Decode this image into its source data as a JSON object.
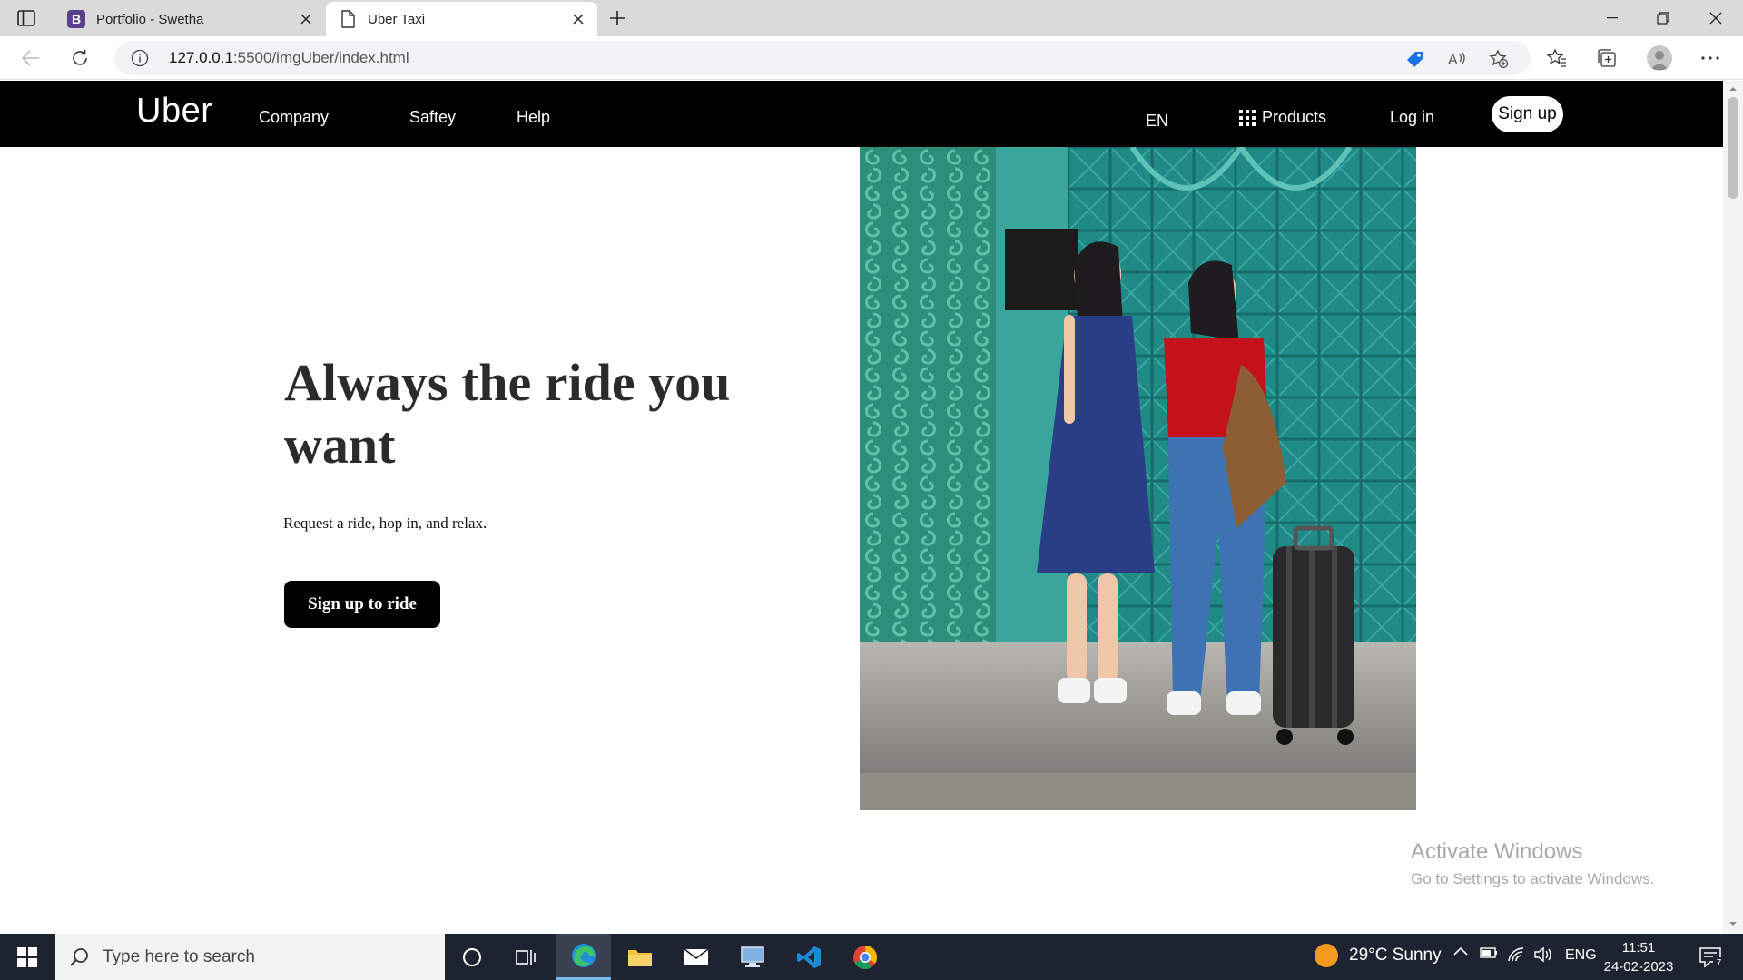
{
  "browser": {
    "tabs": [
      {
        "title": "Portfolio - Swetha",
        "favicon": "B",
        "favicon_color": "#5b3f8c"
      },
      {
        "title": "Uber Taxi"
      }
    ],
    "url_host": "127.0.0.1",
    "url_rest": ":5500/imgUber/index.html"
  },
  "site": {
    "logo": "Uber",
    "nav": {
      "company": "Company",
      "safety": "Saftey",
      "help": "Help",
      "lang": "EN",
      "products": "Products",
      "login": "Log in",
      "signup": "Sign up"
    },
    "hero": {
      "title": "Always the ride you want",
      "subtitle": "Request a ride, hop in, and relax.",
      "cta": "Sign up to ride"
    }
  },
  "watermark": {
    "line1": "Activate Windows",
    "line2": "Go to Settings to activate Windows."
  },
  "taskbar": {
    "search_placeholder": "Type here to search",
    "weather": "29°C  Sunny",
    "lang": "ENG",
    "time": "11:51",
    "date": "24-02-2023",
    "notification_count": "7"
  },
  "colors": {
    "nav_bg": "#000000",
    "taskbar_bg": "#1d2330",
    "cta_bg": "#000000"
  }
}
